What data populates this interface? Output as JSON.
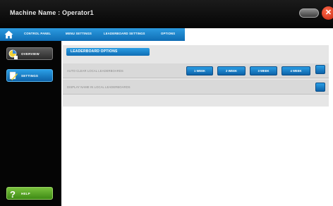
{
  "window": {
    "title": "Machine Name : Operator1",
    "close_glyph": "✕"
  },
  "nav": {
    "home_icon": "home-icon",
    "items": [
      "CONTROL PANEL",
      "MENU SETTINGS",
      "LEADERBOARD SETTINGS",
      "OPTIONS"
    ]
  },
  "sidebar": {
    "items": [
      {
        "label": "OVERVIEW",
        "icon": "overview-icon"
      },
      {
        "label": "SETTINGS",
        "icon": "settings-icon"
      },
      {
        "label": "HELP",
        "icon": "help-icon"
      }
    ],
    "selected": "SETTINGS"
  },
  "leaderboard_options": {
    "header": "LEADERBOARD OPTIONS",
    "rows": [
      {
        "label": "AUTO CLEAR LOCAL LEADERBOARDS",
        "buttons": [
          "1 WEEK",
          "2 WEEK",
          "3 WEEK",
          "4 WEEK"
        ]
      },
      {
        "label": "DISPLAY NAME IN LOCAL LEADERBOARDS"
      }
    ]
  },
  "colors": {
    "accent_blue": "#1a83cc",
    "help_green": "#5aa829",
    "close_red": "#d8341a",
    "sidebar_bg": "#050505"
  }
}
